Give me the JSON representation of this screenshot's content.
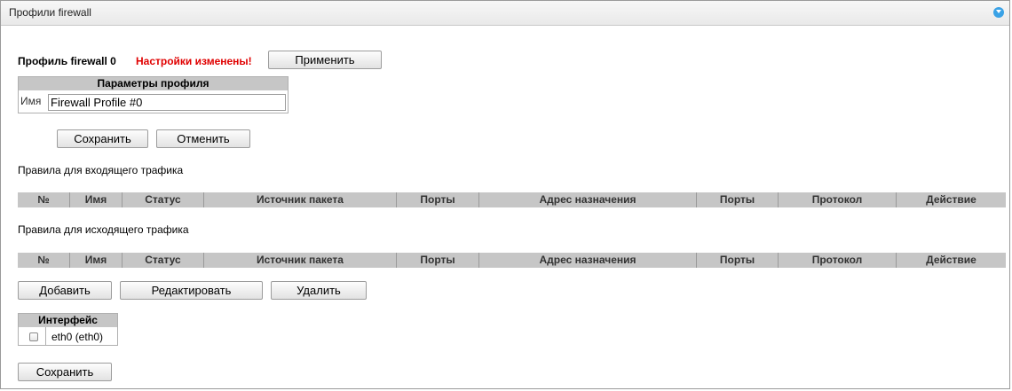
{
  "panel": {
    "title": "Профили firewall",
    "collapse_icon": "collapse-arrow-icon"
  },
  "profile": {
    "label": "Профиль firewall 0",
    "changed_notice": "Настройки изменены!",
    "apply_label": "Применить"
  },
  "params": {
    "header": "Параметры профиля",
    "name_label": "Имя",
    "name_value": "Firewall Profile #0",
    "save_label": "Сохранить",
    "cancel_label": "Отменить"
  },
  "inbound": {
    "title": "Правила для входящего трафика",
    "columns": [
      "№",
      "Имя",
      "Статус",
      "Источник пакета",
      "Порты",
      "Адрес назначения",
      "Порты",
      "Протокол",
      "Действие"
    ]
  },
  "outbound": {
    "title": "Правила для исходящего трафика",
    "columns": [
      "№",
      "Имя",
      "Статус",
      "Источник пакета",
      "Порты",
      "Адрес назначения",
      "Порты",
      "Протокол",
      "Действие"
    ]
  },
  "actions": {
    "add_label": "Добавить",
    "edit_label": "Редактировать",
    "delete_label": "Удалить"
  },
  "interfaces": {
    "header": "Интерфейс",
    "items": [
      {
        "label": "eth0 (eth0)",
        "checked": false
      }
    ],
    "save_label": "Сохранить"
  },
  "colors": {
    "accent": "#3aa2e6",
    "warning": "#e00000",
    "table_header": "#c6c6c6"
  }
}
